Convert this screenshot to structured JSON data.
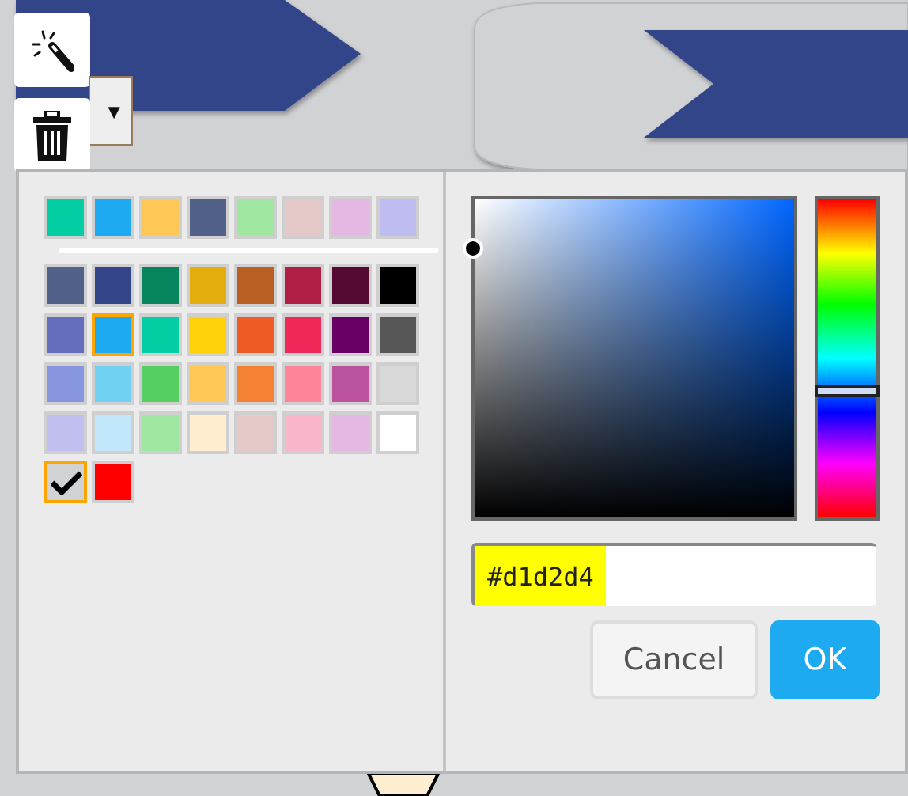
{
  "toolbar": {
    "caret": "▼"
  },
  "palette": {
    "recent": [
      {
        "color": "#03cea4",
        "selected": false
      },
      {
        "color": "#1eaaf1",
        "selected": false
      },
      {
        "color": "#ffc857",
        "selected": false
      },
      {
        "color": "#51618a",
        "selected": false
      },
      {
        "color": "#a0e8a1",
        "selected": false
      },
      {
        "color": "#e5c8c8",
        "selected": false
      },
      {
        "color": "#e5b8e4",
        "selected": false
      },
      {
        "color": "#bebcf0",
        "selected": false
      }
    ],
    "swatches": [
      {
        "kind": "color",
        "color": "#51618a",
        "selected": false
      },
      {
        "kind": "color",
        "color": "#334488",
        "selected": false
      },
      {
        "kind": "color",
        "color": "#06855f",
        "selected": false
      },
      {
        "kind": "color",
        "color": "#e5ae0f",
        "selected": false
      },
      {
        "kind": "color",
        "color": "#b85f24",
        "selected": false
      },
      {
        "kind": "color",
        "color": "#b01e43",
        "selected": false
      },
      {
        "kind": "color",
        "color": "#550a33",
        "selected": false
      },
      {
        "kind": "color",
        "color": "#000000",
        "selected": false
      },
      {
        "kind": "color",
        "color": "#646cbc",
        "selected": false
      },
      {
        "kind": "color",
        "color": "#1eaaf1",
        "selected": true
      },
      {
        "kind": "color",
        "color": "#03cea4",
        "selected": false
      },
      {
        "kind": "color",
        "color": "#ffd20b",
        "selected": false
      },
      {
        "kind": "color",
        "color": "#f05a24",
        "selected": false
      },
      {
        "kind": "color",
        "color": "#f02859",
        "selected": false
      },
      {
        "kind": "color",
        "color": "#680066",
        "selected": false
      },
      {
        "kind": "color",
        "color": "#575757",
        "selected": false
      },
      {
        "kind": "color",
        "color": "#8895df",
        "selected": false
      },
      {
        "kind": "color",
        "color": "#70d1f3",
        "selected": false
      },
      {
        "kind": "color",
        "color": "#55cf61",
        "selected": false
      },
      {
        "kind": "color",
        "color": "#ffc857",
        "selected": false
      },
      {
        "kind": "color",
        "color": "#f48134",
        "selected": false
      },
      {
        "kind": "color",
        "color": "#fe8499",
        "selected": false
      },
      {
        "kind": "color",
        "color": "#bb52a0",
        "selected": false
      },
      {
        "kind": "color",
        "color": "#d9d9d9",
        "selected": false
      },
      {
        "kind": "color",
        "color": "#c0bff0",
        "selected": false
      },
      {
        "kind": "color",
        "color": "#c2e7fa",
        "selected": false
      },
      {
        "kind": "color",
        "color": "#a0e8a1",
        "selected": false
      },
      {
        "kind": "color",
        "color": "#ffeecf",
        "selected": false
      },
      {
        "kind": "color",
        "color": "#e5c8c8",
        "selected": false
      },
      {
        "kind": "color",
        "color": "#f9b6ca",
        "selected": false
      },
      {
        "kind": "color",
        "color": "#e5b8e4",
        "selected": false
      },
      {
        "kind": "color",
        "color": "#ffffff",
        "selected": false
      },
      {
        "kind": "current",
        "color": "#d1d2d4",
        "selected": true
      },
      {
        "kind": "color",
        "color": "#ff0000",
        "selected": false
      }
    ]
  },
  "hex_field": {
    "value": "#d1d2d4",
    "highlighted": true
  },
  "buttons": [
    {
      "label": "Cancel",
      "kind": "secondary"
    },
    {
      "label": "OK",
      "kind": "primary"
    }
  ]
}
